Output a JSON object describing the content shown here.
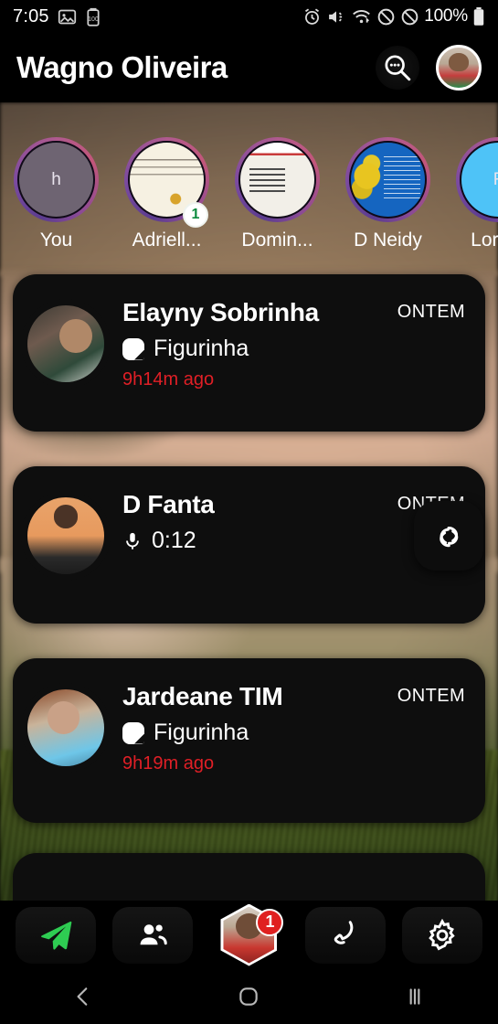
{
  "status_bar": {
    "clock": "7:05",
    "battery_percent": "100%",
    "icons": [
      "image-icon",
      "battery-saver-icon",
      "alarm-icon",
      "vibrate-mute-icon",
      "wifi-icon",
      "do-not-disturb-icon",
      "blocked-icon",
      "battery-icon"
    ]
  },
  "header": {
    "title": "Wagno Oliveira",
    "search_icon": "search-chat-icon",
    "avatar": "profile-avatar"
  },
  "stories": [
    {
      "name": "You",
      "letter": "h",
      "variant": "sv-you",
      "badge": null
    },
    {
      "name": "Adriell...",
      "letter": "",
      "variant": "sv-paper",
      "badge": "1"
    },
    {
      "name": "Domin...",
      "letter": "",
      "variant": "sv-doc",
      "badge": null
    },
    {
      "name": "D Neidy",
      "letter": "",
      "variant": "sv-blue",
      "badge": null
    },
    {
      "name": "Lorran",
      "letter": "F",
      "variant": "sv-cyan",
      "badge": null
    }
  ],
  "chats": [
    {
      "name": "Elayny Sobrinha",
      "preview": "Figurinha",
      "preview_icon": "sticker-icon",
      "ago": "9h14m ago",
      "when": "ONTEM",
      "avatar_class": "av-a"
    },
    {
      "name": "D Fanta",
      "preview": "0:12",
      "preview_icon": "microphone-icon",
      "ago": "",
      "when": "ONTEM",
      "avatar_class": "av-b"
    },
    {
      "name": "Jardeane TIM",
      "preview": "Figurinha",
      "preview_icon": "sticker-icon",
      "ago": "9h19m ago",
      "when": "ONTEM",
      "avatar_class": "av-c"
    }
  ],
  "fab": {
    "icon": "loop-refresh-icon"
  },
  "bottom_nav": [
    {
      "icon": "send-plane-icon",
      "label": "",
      "badge": null
    },
    {
      "icon": "contacts-icon",
      "label": "",
      "badge": null
    },
    {
      "icon": "profile-hexagon-avatar",
      "label": "",
      "badge": "1"
    },
    {
      "icon": "phone-icon",
      "label": "",
      "badge": null
    },
    {
      "icon": "settings-gear-icon",
      "label": "",
      "badge": null
    }
  ],
  "android_nav": [
    {
      "icon": "back-icon"
    },
    {
      "icon": "home-icon"
    },
    {
      "icon": "recents-icon"
    }
  ],
  "colors": {
    "accent_red": "#e01f26",
    "badge_green": "#0b8a3d",
    "send_green": "#2ecc52",
    "card_bg": "#0e0e0e"
  }
}
